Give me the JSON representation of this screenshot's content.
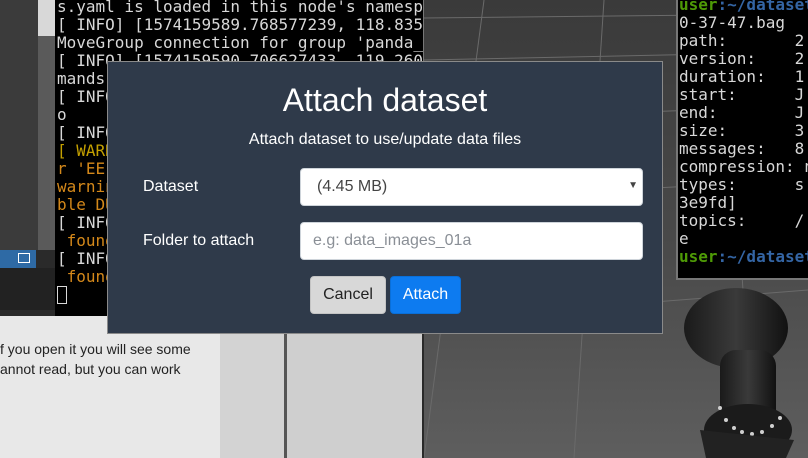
{
  "terminal_left": {
    "lines": [
      "s.yaml is loaded in this node's namesp",
      "[ INFO] [1574159589.768577239, 118.835",
      "MoveGroup connection for group 'panda_",
      "[ INFO] [1574159590.706627433, 119.260",
      "mands",
      "[ INFO",
      "o",
      "[ INFO",
      "[ WARN",
      "r 'EE",
      "warnin",
      "ble DU",
      "[ INFO",
      " found",
      "[ INFO",
      " found"
    ]
  },
  "doc_panel": {
    "line1": "f you open it you will see some",
    "line2": "annot read, but you can work"
  },
  "terminal_right": {
    "prompt_user": "user",
    "prompt_path": ":~/dataset",
    "lines": [
      "0-37-47.bag",
      "path:       2",
      "version:    2",
      "duration:   1",
      "start:      J",
      "end:        J",
      "size:       3",
      "messages:   8",
      "compression: n",
      "types:      s",
      "3e9fd]",
      "topics:     /",
      "e"
    ],
    "prompt2_user": "user",
    "prompt2_path": ":~/dataset"
  },
  "modal": {
    "title": "Attach dataset",
    "subtitle": "Attach dataset to use/update data files",
    "dataset_label": "Dataset",
    "dataset_value": "(4.45 MB)",
    "folder_label": "Folder to attach",
    "folder_placeholder": "e.g: data_images_01a",
    "cancel_label": "Cancel",
    "attach_label": "Attach"
  },
  "colors": {
    "modal_bg": "#2f3a4a",
    "primary": "#0d7bf0",
    "secondary": "#d8d8d8"
  }
}
